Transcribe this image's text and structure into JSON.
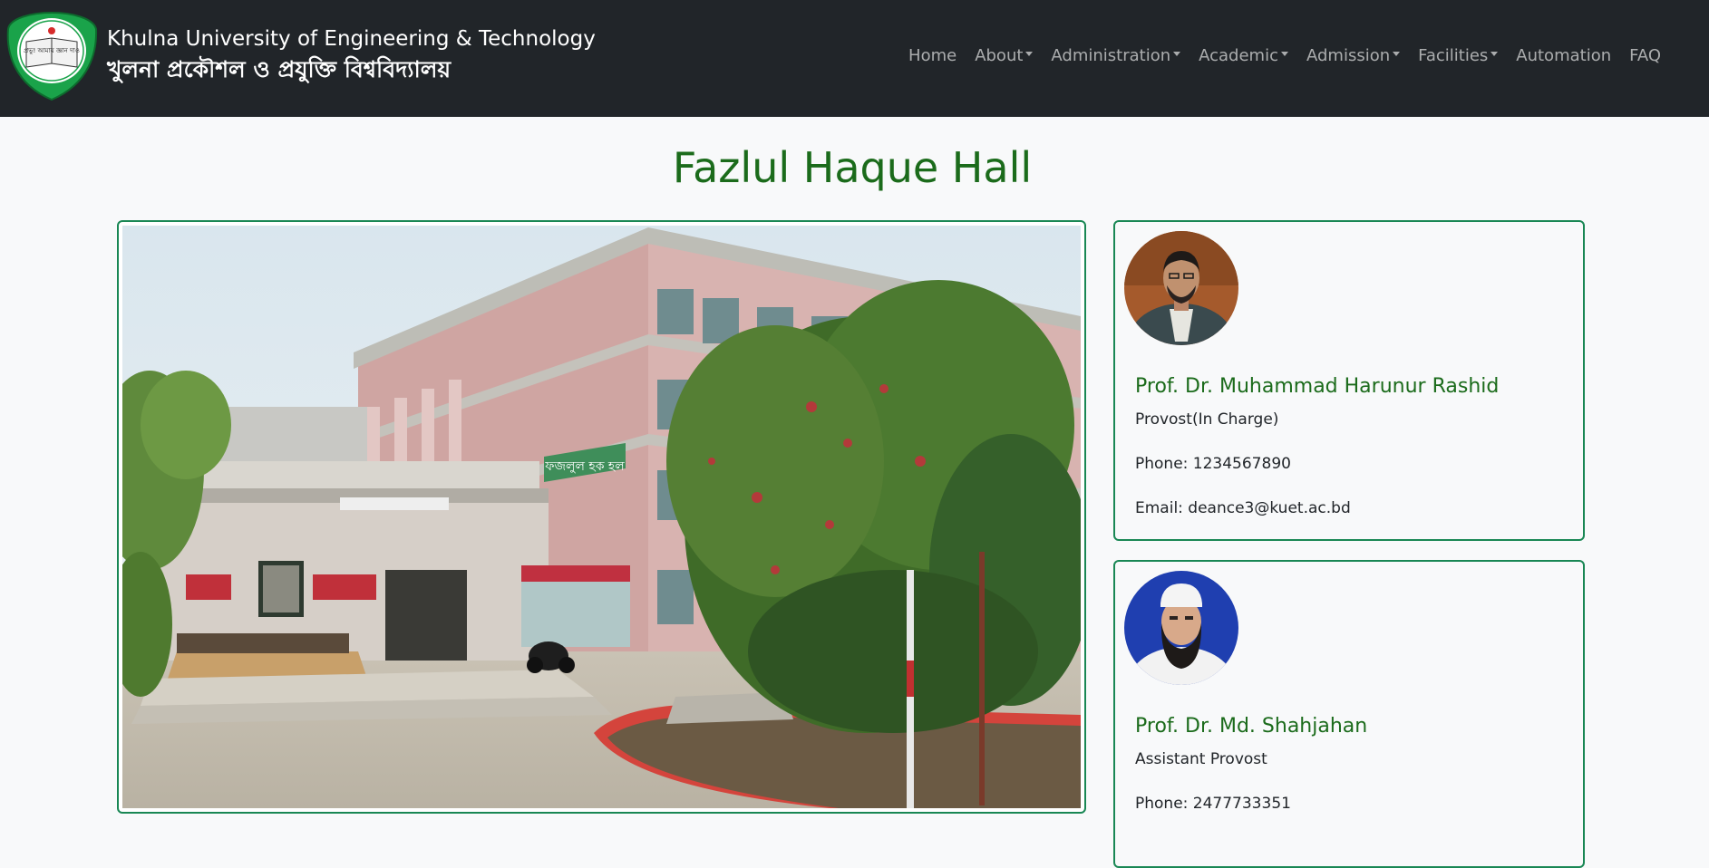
{
  "header": {
    "brand_en": "Khulna University of Engineering & Technology",
    "brand_bn": "খুলনা প্রকৌশল ও প্রযুক্তি বিশ্ববিদ্যালয়",
    "logo_icon": "kuet-logo-icon",
    "logo_text": "প্রভু! আমায় জ্ঞান দাও",
    "colors": {
      "background": "#212529",
      "text": "#ffffff"
    }
  },
  "nav": {
    "items": [
      {
        "label": "Home",
        "dropdown": false
      },
      {
        "label": "About",
        "dropdown": true
      },
      {
        "label": "Administration",
        "dropdown": true
      },
      {
        "label": "Academic",
        "dropdown": true
      },
      {
        "label": "Admission",
        "dropdown": true
      },
      {
        "label": "Facilities",
        "dropdown": true
      },
      {
        "label": "Automation",
        "dropdown": false
      },
      {
        "label": "FAQ",
        "dropdown": false
      }
    ]
  },
  "page": {
    "title": "Fazlul Haque Hall",
    "accent_color": "#1b6b1b",
    "border_color": "#198754"
  },
  "photo": {
    "hall_sign_text": "ফজলুল হক হল",
    "entrance_sign_text": "ফজলুল হক হল"
  },
  "staff": [
    {
      "name": "Prof. Dr. Muhammad Harunur Rashid",
      "role": "Provost(In Charge)",
      "phone": "Phone: 1234567890",
      "email": "Email: deance3@kuet.ac.bd",
      "avatar_icon": "provost-avatar-icon"
    },
    {
      "name": "Prof. Dr. Md. Shahjahan",
      "role": "Assistant Provost",
      "phone": "Phone: 2477733351",
      "avatar_icon": "assistant-provost-avatar-icon"
    }
  ]
}
